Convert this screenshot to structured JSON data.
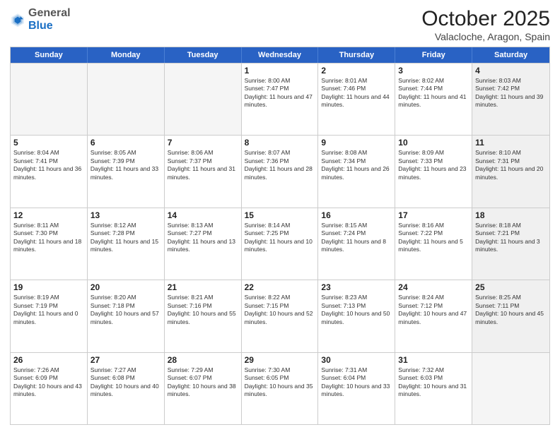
{
  "header": {
    "logo_general": "General",
    "logo_blue": "Blue",
    "month_title": "October 2025",
    "subtitle": "Valacloche, Aragon, Spain"
  },
  "weekdays": [
    "Sunday",
    "Monday",
    "Tuesday",
    "Wednesday",
    "Thursday",
    "Friday",
    "Saturday"
  ],
  "rows": [
    [
      {
        "day": "",
        "text": "",
        "empty": true
      },
      {
        "day": "",
        "text": "",
        "empty": true
      },
      {
        "day": "",
        "text": "",
        "empty": true
      },
      {
        "day": "1",
        "text": "Sunrise: 8:00 AM\nSunset: 7:47 PM\nDaylight: 11 hours and 47 minutes."
      },
      {
        "day": "2",
        "text": "Sunrise: 8:01 AM\nSunset: 7:46 PM\nDaylight: 11 hours and 44 minutes."
      },
      {
        "day": "3",
        "text": "Sunrise: 8:02 AM\nSunset: 7:44 PM\nDaylight: 11 hours and 41 minutes."
      },
      {
        "day": "4",
        "text": "Sunrise: 8:03 AM\nSunset: 7:42 PM\nDaylight: 11 hours and 39 minutes.",
        "shaded": true
      }
    ],
    [
      {
        "day": "5",
        "text": "Sunrise: 8:04 AM\nSunset: 7:41 PM\nDaylight: 11 hours and 36 minutes."
      },
      {
        "day": "6",
        "text": "Sunrise: 8:05 AM\nSunset: 7:39 PM\nDaylight: 11 hours and 33 minutes."
      },
      {
        "day": "7",
        "text": "Sunrise: 8:06 AM\nSunset: 7:37 PM\nDaylight: 11 hours and 31 minutes."
      },
      {
        "day": "8",
        "text": "Sunrise: 8:07 AM\nSunset: 7:36 PM\nDaylight: 11 hours and 28 minutes."
      },
      {
        "day": "9",
        "text": "Sunrise: 8:08 AM\nSunset: 7:34 PM\nDaylight: 11 hours and 26 minutes."
      },
      {
        "day": "10",
        "text": "Sunrise: 8:09 AM\nSunset: 7:33 PM\nDaylight: 11 hours and 23 minutes."
      },
      {
        "day": "11",
        "text": "Sunrise: 8:10 AM\nSunset: 7:31 PM\nDaylight: 11 hours and 20 minutes.",
        "shaded": true
      }
    ],
    [
      {
        "day": "12",
        "text": "Sunrise: 8:11 AM\nSunset: 7:30 PM\nDaylight: 11 hours and 18 minutes."
      },
      {
        "day": "13",
        "text": "Sunrise: 8:12 AM\nSunset: 7:28 PM\nDaylight: 11 hours and 15 minutes."
      },
      {
        "day": "14",
        "text": "Sunrise: 8:13 AM\nSunset: 7:27 PM\nDaylight: 11 hours and 13 minutes."
      },
      {
        "day": "15",
        "text": "Sunrise: 8:14 AM\nSunset: 7:25 PM\nDaylight: 11 hours and 10 minutes."
      },
      {
        "day": "16",
        "text": "Sunrise: 8:15 AM\nSunset: 7:24 PM\nDaylight: 11 hours and 8 minutes."
      },
      {
        "day": "17",
        "text": "Sunrise: 8:16 AM\nSunset: 7:22 PM\nDaylight: 11 hours and 5 minutes."
      },
      {
        "day": "18",
        "text": "Sunrise: 8:18 AM\nSunset: 7:21 PM\nDaylight: 11 hours and 3 minutes.",
        "shaded": true
      }
    ],
    [
      {
        "day": "19",
        "text": "Sunrise: 8:19 AM\nSunset: 7:19 PM\nDaylight: 11 hours and 0 minutes."
      },
      {
        "day": "20",
        "text": "Sunrise: 8:20 AM\nSunset: 7:18 PM\nDaylight: 10 hours and 57 minutes."
      },
      {
        "day": "21",
        "text": "Sunrise: 8:21 AM\nSunset: 7:16 PM\nDaylight: 10 hours and 55 minutes."
      },
      {
        "day": "22",
        "text": "Sunrise: 8:22 AM\nSunset: 7:15 PM\nDaylight: 10 hours and 52 minutes."
      },
      {
        "day": "23",
        "text": "Sunrise: 8:23 AM\nSunset: 7:13 PM\nDaylight: 10 hours and 50 minutes."
      },
      {
        "day": "24",
        "text": "Sunrise: 8:24 AM\nSunset: 7:12 PM\nDaylight: 10 hours and 47 minutes."
      },
      {
        "day": "25",
        "text": "Sunrise: 8:25 AM\nSunset: 7:11 PM\nDaylight: 10 hours and 45 minutes.",
        "shaded": true
      }
    ],
    [
      {
        "day": "26",
        "text": "Sunrise: 7:26 AM\nSunset: 6:09 PM\nDaylight: 10 hours and 43 minutes."
      },
      {
        "day": "27",
        "text": "Sunrise: 7:27 AM\nSunset: 6:08 PM\nDaylight: 10 hours and 40 minutes."
      },
      {
        "day": "28",
        "text": "Sunrise: 7:29 AM\nSunset: 6:07 PM\nDaylight: 10 hours and 38 minutes."
      },
      {
        "day": "29",
        "text": "Sunrise: 7:30 AM\nSunset: 6:05 PM\nDaylight: 10 hours and 35 minutes."
      },
      {
        "day": "30",
        "text": "Sunrise: 7:31 AM\nSunset: 6:04 PM\nDaylight: 10 hours and 33 minutes."
      },
      {
        "day": "31",
        "text": "Sunrise: 7:32 AM\nSunset: 6:03 PM\nDaylight: 10 hours and 31 minutes."
      },
      {
        "day": "",
        "text": "",
        "empty": true,
        "shaded": true
      }
    ]
  ]
}
